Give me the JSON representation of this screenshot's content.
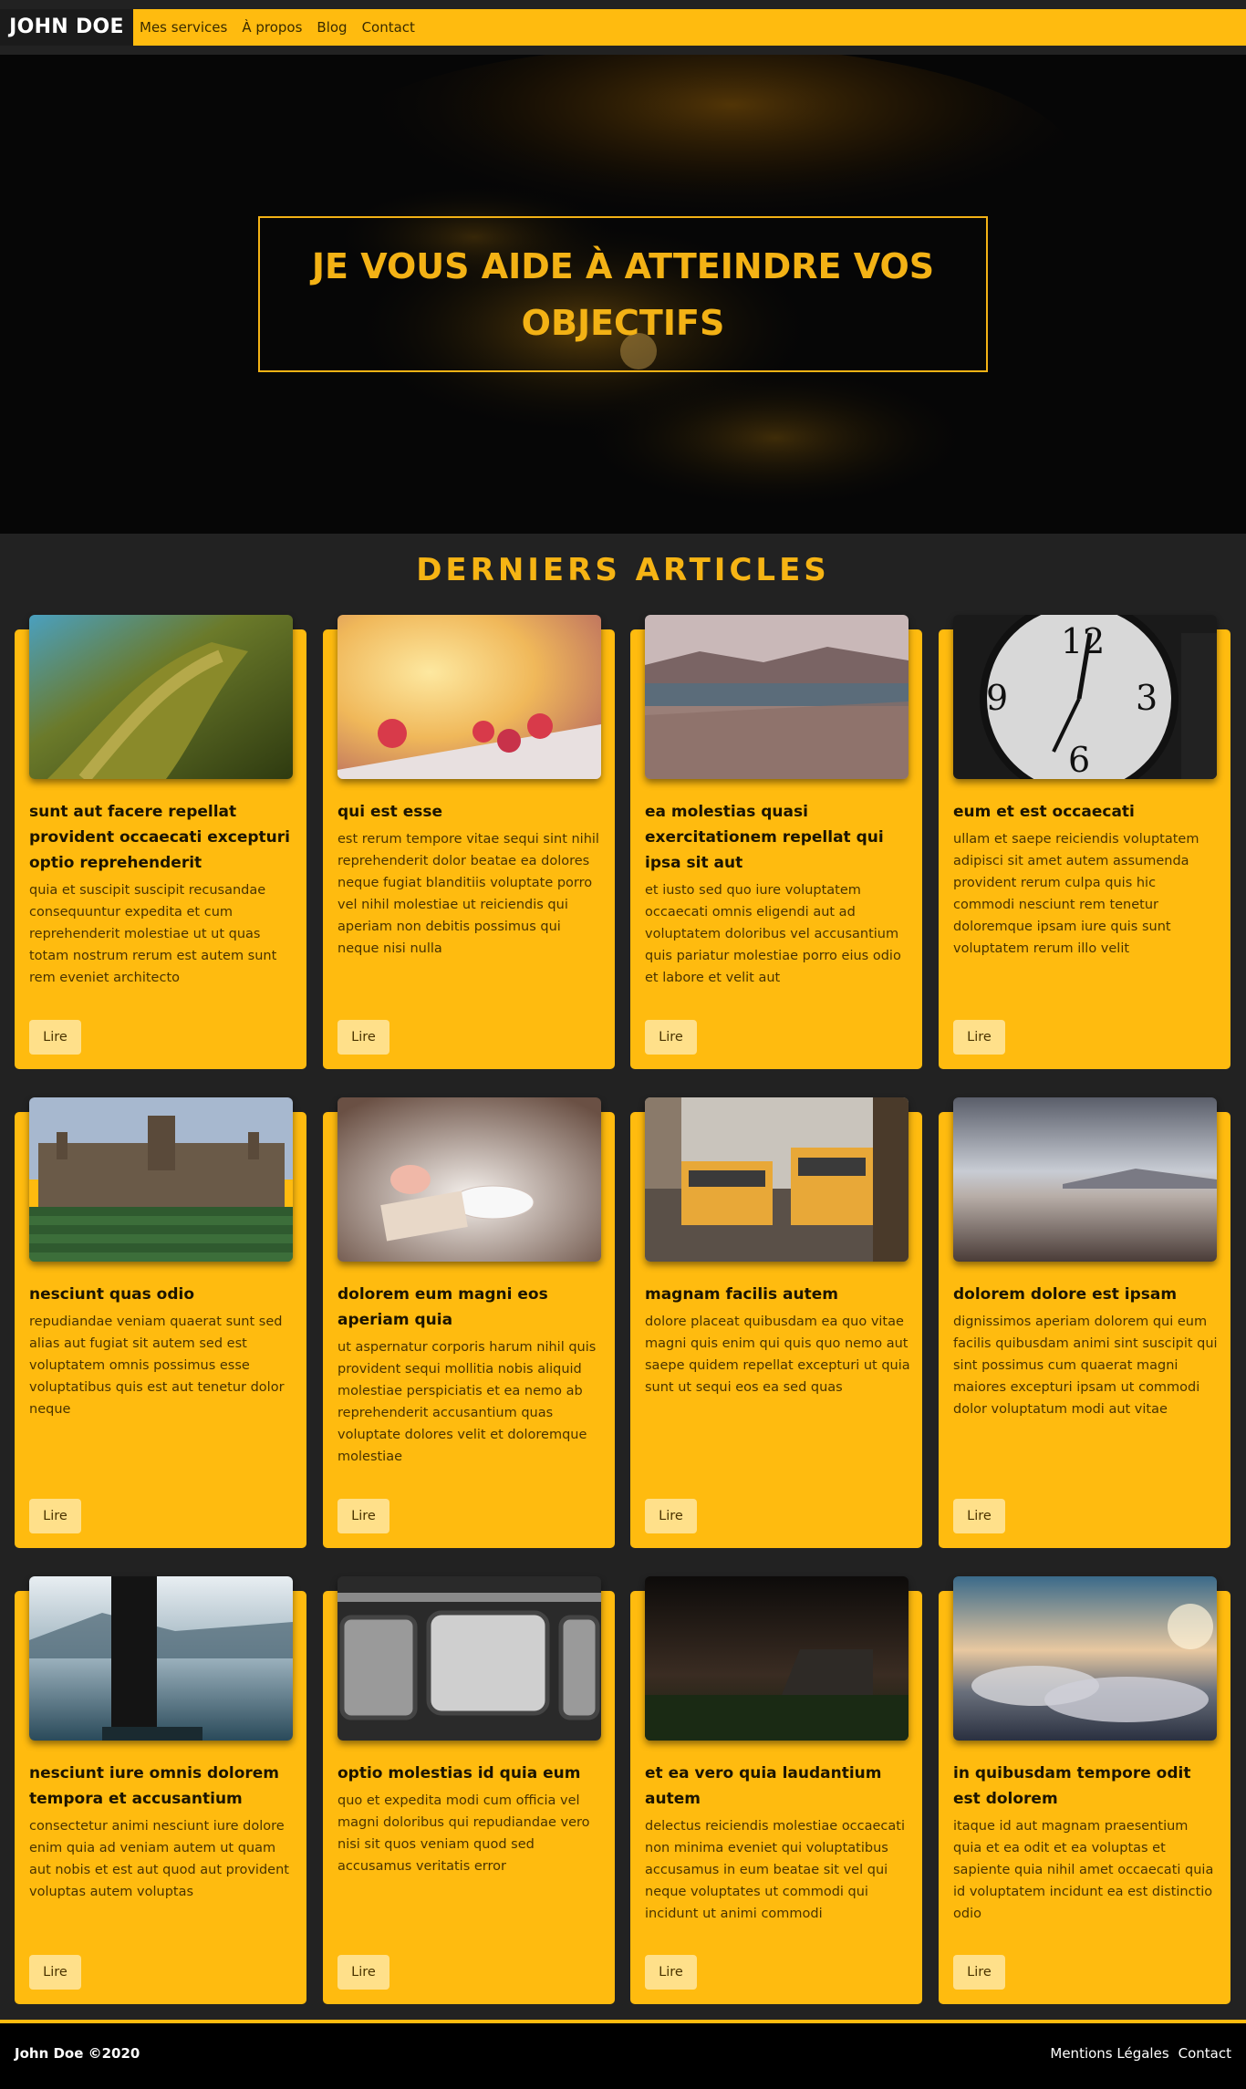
{
  "brand": "JOHN DOE",
  "nav": [
    "Mes services",
    "À propos",
    "Blog",
    "Contact"
  ],
  "hero": {
    "title": "JE VOUS AIDE À ATTEINDRE VOS OBJECTIFS"
  },
  "section_title": "DERNIERS ARTICLES",
  "button_label": "Lire",
  "articles": [
    {
      "title": "sunt aut facere repellat provident occaecati excepturi optio reprehenderit",
      "body": "quia et suscipit suscipit recusandae consequuntur expedita et cum reprehenderit molestiae ut ut quas totam nostrum rerum est autem sunt rem eveniet architecto",
      "image": "mossy-tree"
    },
    {
      "title": "qui est esse",
      "body": "est rerum tempore vitae sequi sint nihil reprehenderit dolor beatae ea dolores neque fugiat blanditiis voluptate porro vel nihil molestiae ut reiciendis qui aperiam non debitis possimus qui neque nisi nulla",
      "image": "raspberries"
    },
    {
      "title": "ea molestias quasi exercitationem repellat qui ipsa sit aut",
      "body": "et iusto sed quo iure voluptatem occaecati omnis eligendi aut ad voluptatem doloribus vel accusantium quis pariatur molestiae porro eius odio et labore et velit aut",
      "image": "lake-field"
    },
    {
      "title": "eum et est occaecati",
      "body": "ullam et saepe reiciendis voluptatem adipisci sit amet autem assumenda provident rerum culpa quis hic commodi nesciunt rem tenetur doloremque ipsam iure quis sunt voluptatem rerum illo velit",
      "image": "clock"
    },
    {
      "title": "nesciunt quas odio",
      "body": "repudiandae veniam quaerat sunt sed alias aut fugiat sit autem sed est voluptatem omnis possimus esse voluptatibus quis est aut tenetur dolor neque",
      "image": "college"
    },
    {
      "title": "dolorem eum magni eos aperiam quia",
      "body": "ut aspernatur corporis harum nihil quis provident sequi mollitia nobis aliquid molestiae perspiciatis et ea nemo ab reprehenderit accusantium quas voluptate dolores velit et doloremque molestiae",
      "image": "teacup"
    },
    {
      "title": "magnam facilis autem",
      "body": "dolore placeat quibusdam ea quo vitae magni quis enim qui quis quo nemo aut saepe quidem repellat excepturi ut quia sunt ut sequi eos ea sed quas",
      "image": "trams"
    },
    {
      "title": "dolorem dolore est ipsam",
      "body": "dignissimos aperiam dolorem qui eum facilis quibusdam animi sint suscipit qui sint possimus cum quaerat magni maiores excepturi ipsam ut commodi dolor voluptatum modi aut vitae",
      "image": "beach"
    },
    {
      "title": "nesciunt iure omnis dolorem tempora et accusantium",
      "body": "consectetur animi nesciunt iure dolore enim quia ad veniam autem ut quam aut nobis et est aut quod aut provident voluptas autem voluptas",
      "image": "misty-lake-person"
    },
    {
      "title": "optio molestias id quia eum",
      "body": "quo et expedita modi cum officia vel magni doloribus qui repudiandae vero nisi sit quos veniam quod sed accusamus veritatis error",
      "image": "train-windows"
    },
    {
      "title": "et ea vero quia laudantium autem",
      "body": "delectus reiciendis molestiae occaecati non minima eveniet qui voluptatibus accusamus in eum beatae sit vel qui neque voluptates ut commodi qui incidunt ut animi commodi",
      "image": "night-barn"
    },
    {
      "title": "in quibusdam tempore odit est dolorem",
      "body": "itaque id aut magnam praesentium quia et ea odit et ea voluptas et sapiente quia nihil amet occaecati quia id voluptatem incidunt ea est distinctio odio",
      "image": "clouds"
    }
  ],
  "footer": {
    "copyright": "John Doe ©2020",
    "links": [
      "Mentions Légales",
      "Contact"
    ]
  }
}
